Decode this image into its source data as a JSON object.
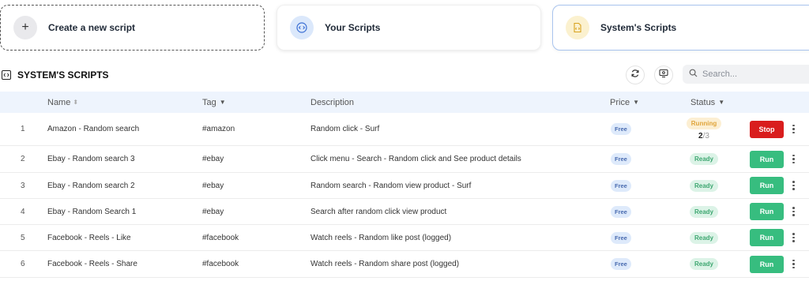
{
  "cards": {
    "create": "Create a new script",
    "yours": "Your Scripts",
    "system": "System's Scripts"
  },
  "section_title": "SYSTEM'S SCRIPTS",
  "search": {
    "placeholder": "Search..."
  },
  "columns": {
    "name": "Name",
    "tag": "Tag",
    "description": "Description",
    "price": "Price",
    "status": "Status"
  },
  "rows": [
    {
      "index": "1",
      "name": "Amazon - Random search",
      "tag": "#amazon",
      "description": "Random click - Surf",
      "price": "Free",
      "status": "Running",
      "progress_current": "2",
      "progress_total": "/3",
      "action": "Stop"
    },
    {
      "index": "2",
      "name": "Ebay - Random search 3",
      "tag": "#ebay",
      "description": "Click menu - Search - Random click and See product details",
      "price": "Free",
      "status": "Ready",
      "action": "Run"
    },
    {
      "index": "3",
      "name": "Ebay - Random search 2",
      "tag": "#ebay",
      "description": "Random search - Random view product - Surf",
      "price": "Free",
      "status": "Ready",
      "action": "Run"
    },
    {
      "index": "4",
      "name": "Ebay - Random Search 1",
      "tag": "#ebay",
      "description": "Search after random click view product",
      "price": "Free",
      "status": "Ready",
      "action": "Run"
    },
    {
      "index": "5",
      "name": "Facebook - Reels - Like",
      "tag": "#facebook",
      "description": "Watch reels - Random like post (logged)",
      "price": "Free",
      "status": "Ready",
      "action": "Run"
    },
    {
      "index": "6",
      "name": "Facebook - Reels - Share",
      "tag": "#facebook",
      "description": "Watch reels - Random share post (logged)",
      "price": "Free",
      "status": "Ready",
      "action": "Run"
    }
  ],
  "colors": {
    "run": "#37bd7f",
    "stop": "#d91d1d",
    "header_bg": "#eef4fd",
    "running": "#e0a43a",
    "ready": "#3ea771"
  },
  "icons": {
    "create": "plus-icon",
    "yours": "code-icon",
    "system": "document-code-icon",
    "title": "code-box-icon",
    "refresh": "refresh-icon",
    "monitor": "monitor-icon",
    "search": "search-icon",
    "more": "more-vertical-icon"
  }
}
